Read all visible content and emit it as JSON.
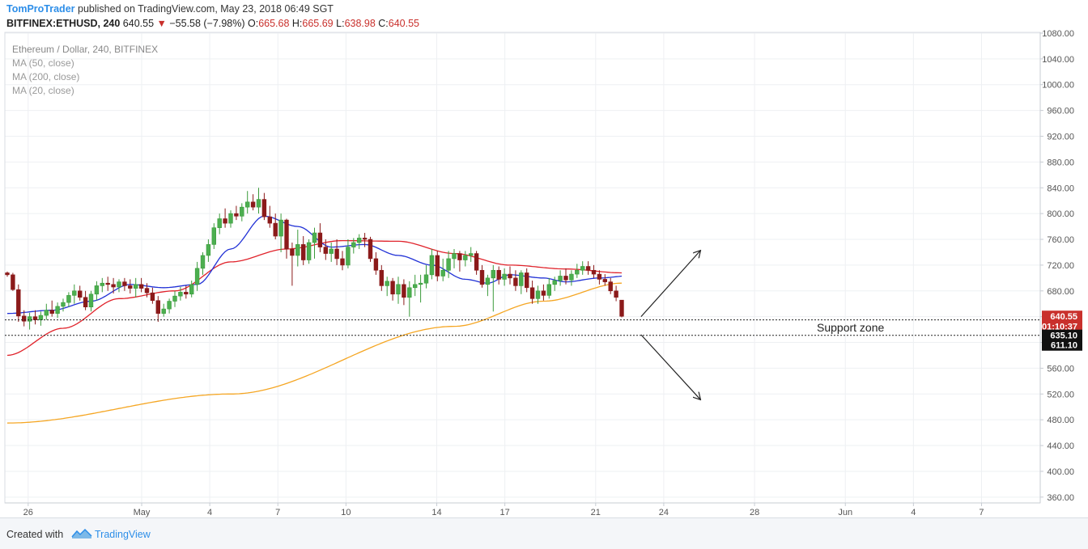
{
  "header": {
    "author": "TomProTrader",
    "published_text": "published on TradingView.com, May 23, 2018 06:49 SGT",
    "symbol": "BITFINEX:ETHUSD, 240",
    "last": "640.55",
    "change_arrow": "▼",
    "change": "−55.58 (−7.98%)",
    "o_label": "O:",
    "o_value": "665.68",
    "h_label": "H:",
    "h_value": "665.69",
    "l_label": "L:",
    "l_value": "638.98",
    "c_label": "C:",
    "c_value": "640.55"
  },
  "legend": {
    "title": "Ethereum / Dollar, 240, BITFINEX",
    "ma50": "MA (50, close)",
    "ma200": "MA (200, close)",
    "ma20": "MA (20, close)"
  },
  "footer": {
    "created_with": "Created with",
    "brand": "TradingView"
  },
  "colors": {
    "up": "#3b9b3b",
    "down": "#8b1a1a",
    "ma20": "#2232d6",
    "ma50": "#e0232b",
    "ma200": "#f5a623",
    "grid": "#eef0f3",
    "axis_text": "#555555",
    "price_badge": "#c9302c"
  },
  "chart_data": {
    "type": "candlestick",
    "y_range": [
      350,
      1090
    ],
    "y_ticks": [
      360,
      400,
      440,
      480,
      520,
      560,
      600,
      640,
      680,
      720,
      760,
      800,
      840,
      880,
      920,
      960,
      1000,
      1040,
      1080
    ],
    "x_labels": [
      "26",
      "May",
      "4",
      "7",
      "10",
      "14",
      "17",
      "21",
      "24",
      "28",
      "Jun",
      "4",
      "7"
    ],
    "price_labels": [
      {
        "text": "640.55",
        "value": 640.55,
        "style": "red"
      },
      {
        "text": "01:10:37",
        "value": 625,
        "style": "red"
      },
      {
        "text": "635.10",
        "value": 611.1,
        "style": "black"
      },
      {
        "text": "611.10",
        "value": 596,
        "style": "black"
      }
    ],
    "support_zone": {
      "label": "Support zone",
      "upper": 635.1,
      "lower": 611.1
    },
    "annotations": [
      {
        "type": "arrow",
        "from": [
          23.0,
          640
        ],
        "to": [
          25.6,
          742
        ]
      },
      {
        "type": "arrow",
        "from": [
          23.0,
          612
        ],
        "to": [
          25.6,
          512
        ]
      }
    ],
    "candles": [
      [
        708,
        710,
        702,
        705
      ],
      [
        705,
        708,
        680,
        682
      ],
      [
        682,
        690,
        632,
        641
      ],
      [
        641,
        650,
        625,
        633
      ],
      [
        633,
        646,
        620,
        640
      ],
      [
        640,
        650,
        628,
        635
      ],
      [
        635,
        648,
        626,
        642
      ],
      [
        642,
        660,
        635,
        650
      ],
      [
        650,
        665,
        640,
        645
      ],
      [
        645,
        662,
        638,
        656
      ],
      [
        656,
        668,
        648,
        662
      ],
      [
        662,
        678,
        655,
        673
      ],
      [
        673,
        690,
        660,
        680
      ],
      [
        680,
        688,
        665,
        670
      ],
      [
        670,
        680,
        650,
        655
      ],
      [
        655,
        680,
        648,
        675
      ],
      [
        675,
        695,
        665,
        688
      ],
      [
        688,
        700,
        678,
        692
      ],
      [
        692,
        702,
        680,
        690
      ],
      [
        690,
        700,
        676,
        686
      ],
      [
        686,
        698,
        678,
        694
      ],
      [
        694,
        700,
        680,
        688
      ],
      [
        688,
        698,
        676,
        684
      ],
      [
        684,
        700,
        670,
        690
      ],
      [
        690,
        700,
        678,
        684
      ],
      [
        684,
        692,
        670,
        677
      ],
      [
        677,
        685,
        660,
        665
      ],
      [
        665,
        672,
        632,
        645
      ],
      [
        645,
        660,
        640,
        652
      ],
      [
        652,
        668,
        645,
        664
      ],
      [
        664,
        680,
        655,
        672
      ],
      [
        672,
        686,
        665,
        678
      ],
      [
        678,
        688,
        668,
        675
      ],
      [
        675,
        696,
        670,
        690
      ],
      [
        690,
        725,
        680,
        715
      ],
      [
        715,
        740,
        705,
        735
      ],
      [
        735,
        760,
        725,
        752
      ],
      [
        752,
        785,
        745,
        778
      ],
      [
        778,
        800,
        768,
        792
      ],
      [
        792,
        808,
        778,
        785
      ],
      [
        785,
        805,
        778,
        800
      ],
      [
        800,
        812,
        790,
        796
      ],
      [
        796,
        816,
        788,
        810
      ],
      [
        810,
        835,
        800,
        818
      ],
      [
        818,
        830,
        805,
        810
      ],
      [
        810,
        840,
        800,
        822
      ],
      [
        822,
        832,
        790,
        795
      ],
      [
        795,
        812,
        778,
        785
      ],
      [
        785,
        800,
        760,
        765
      ],
      [
        765,
        800,
        740,
        790
      ],
      [
        790,
        792,
        730,
        745
      ],
      [
        745,
        755,
        688,
        735
      ],
      [
        735,
        775,
        718,
        752
      ],
      [
        752,
        765,
        720,
        728
      ],
      [
        728,
        760,
        722,
        755
      ],
      [
        755,
        778,
        730,
        770
      ],
      [
        770,
        785,
        740,
        748
      ],
      [
        748,
        760,
        728,
        738
      ],
      [
        738,
        755,
        725,
        745
      ],
      [
        745,
        760,
        720,
        730
      ],
      [
        730,
        742,
        712,
        720
      ],
      [
        720,
        760,
        715,
        748
      ],
      [
        748,
        762,
        738,
        755
      ],
      [
        755,
        768,
        745,
        762
      ],
      [
        762,
        770,
        748,
        760
      ],
      [
        760,
        764,
        725,
        730
      ],
      [
        730,
        740,
        705,
        712
      ],
      [
        712,
        720,
        680,
        688
      ],
      [
        688,
        702,
        672,
        695
      ],
      [
        695,
        700,
        665,
        675
      ],
      [
        675,
        702,
        660,
        690
      ],
      [
        690,
        698,
        658,
        670
      ],
      [
        670,
        695,
        640,
        685
      ],
      [
        685,
        705,
        672,
        690
      ],
      [
        690,
        705,
        662,
        692
      ],
      [
        692,
        720,
        684,
        705
      ],
      [
        705,
        745,
        698,
        735
      ],
      [
        735,
        742,
        695,
        703
      ],
      [
        703,
        730,
        695,
        712
      ],
      [
        712,
        742,
        700,
        730
      ],
      [
        730,
        745,
        715,
        738
      ],
      [
        738,
        742,
        710,
        728
      ],
      [
        728,
        742,
        718,
        735
      ],
      [
        735,
        748,
        725,
        738
      ],
      [
        738,
        742,
        705,
        712
      ],
      [
        712,
        720,
        685,
        690
      ],
      [
        690,
        705,
        672,
        700
      ],
      [
        700,
        720,
        648,
        712
      ],
      [
        712,
        718,
        690,
        698
      ],
      [
        698,
        715,
        688,
        706
      ],
      [
        706,
        718,
        690,
        700
      ],
      [
        700,
        712,
        680,
        688
      ],
      [
        688,
        712,
        675,
        708
      ],
      [
        708,
        715,
        678,
        685
      ],
      [
        685,
        696,
        660,
        668
      ],
      [
        668,
        688,
        660,
        680
      ],
      [
        680,
        690,
        665,
        673
      ],
      [
        673,
        700,
        668,
        690
      ],
      [
        690,
        702,
        680,
        696
      ],
      [
        696,
        712,
        688,
        703
      ],
      [
        703,
        715,
        690,
        697
      ],
      [
        697,
        712,
        688,
        706
      ],
      [
        706,
        722,
        700,
        712
      ],
      [
        712,
        726,
        705,
        718
      ],
      [
        718,
        726,
        705,
        712
      ],
      [
        712,
        720,
        700,
        706
      ],
      [
        706,
        712,
        690,
        698
      ],
      [
        698,
        706,
        688,
        694
      ],
      [
        694,
        700,
        675,
        680
      ],
      [
        680,
        688,
        664,
        670
      ],
      [
        665.68,
        665.69,
        638.98,
        640.55
      ]
    ],
    "ma200_anchors": [
      [
        0,
        475
      ],
      [
        40,
        520
      ],
      [
        80,
        625
      ],
      [
        96,
        664
      ],
      [
        110,
        692
      ],
      [
        118,
        702
      ]
    ],
    "ma50_anchors": [
      [
        0,
        580
      ],
      [
        10,
        622
      ],
      [
        20,
        668
      ],
      [
        30,
        680
      ],
      [
        40,
        725
      ],
      [
        50,
        745
      ],
      [
        60,
        758
      ],
      [
        70,
        757
      ],
      [
        80,
        738
      ],
      [
        90,
        720
      ],
      [
        100,
        714
      ],
      [
        110,
        708
      ],
      [
        118,
        700
      ]
    ],
    "ma20_anchors": [
      [
        0,
        645
      ],
      [
        8,
        650
      ],
      [
        15,
        664
      ],
      [
        22,
        690
      ],
      [
        28,
        685
      ],
      [
        34,
        690
      ],
      [
        40,
        745
      ],
      [
        46,
        796
      ],
      [
        52,
        780
      ],
      [
        58,
        748
      ],
      [
        64,
        752
      ],
      [
        70,
        735
      ],
      [
        76,
        720
      ],
      [
        82,
        698
      ],
      [
        86,
        692
      ],
      [
        90,
        705
      ],
      [
        96,
        700
      ],
      [
        100,
        694
      ],
      [
        106,
        700
      ],
      [
        112,
        704
      ],
      [
        118,
        698
      ]
    ]
  }
}
